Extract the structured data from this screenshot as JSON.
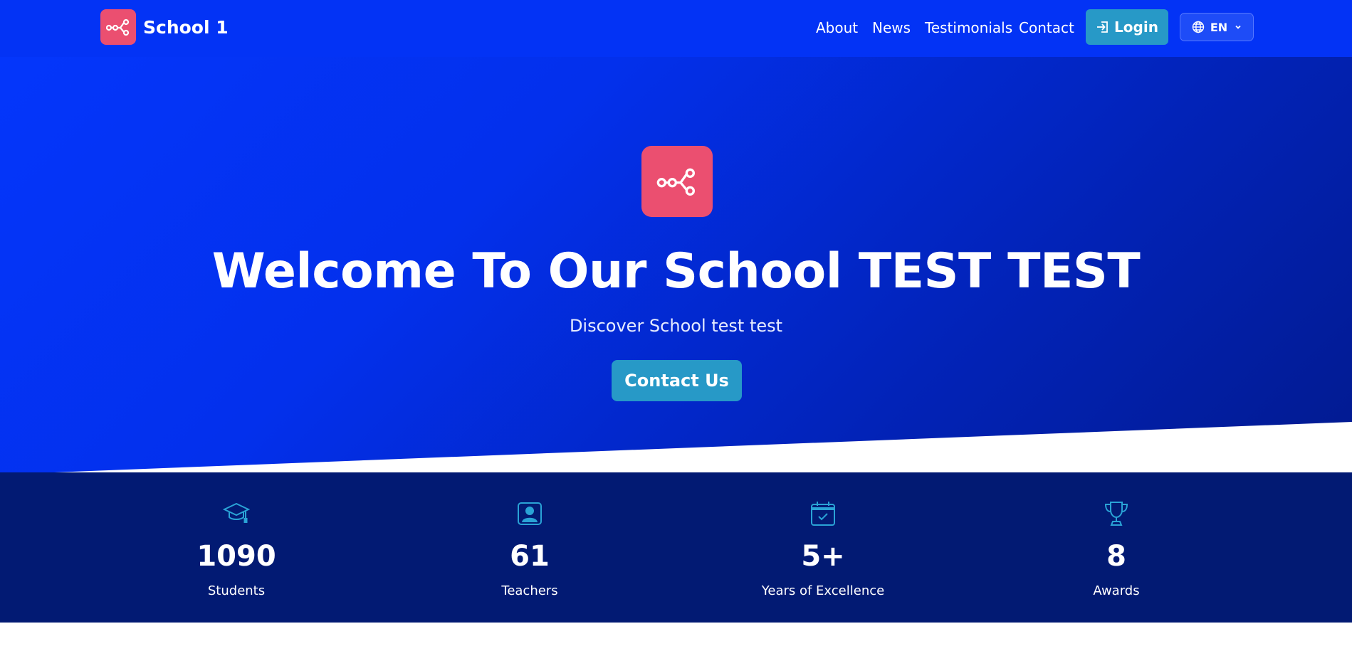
{
  "colors": {
    "nav_bg": "#0333f5",
    "hero_gradient_start": "#0436fb",
    "hero_gradient_end": "#021a8f",
    "brand_accent": "#eb4f70",
    "button_accent": "#2799c7",
    "stats_bg": "#021a73",
    "stat_icon": "#2aa3d6"
  },
  "navbar": {
    "brand_name": "School 1",
    "brand_icon": "share-nodes-icon",
    "links": [
      {
        "label": "About"
      },
      {
        "label": "News"
      },
      {
        "label": "Testimonials"
      },
      {
        "label": "Contact"
      }
    ],
    "login": {
      "label": "Login",
      "icon": "login-icon"
    },
    "language": {
      "label": "EN",
      "icon": "globe-icon"
    }
  },
  "hero": {
    "logo_icon": "share-nodes-icon",
    "title": "Welcome To Our School TEST TEST",
    "subtitle": "Discover School test test",
    "cta_label": "Contact Us"
  },
  "stats": [
    {
      "icon": "graduation-cap-icon",
      "value": "1090",
      "label": "Students"
    },
    {
      "icon": "teacher-icon",
      "value": "61",
      "label": "Teachers"
    },
    {
      "icon": "calendar-check-icon",
      "value": "5+",
      "label": "Years of Excellence"
    },
    {
      "icon": "trophy-icon",
      "value": "8",
      "label": "Awards"
    }
  ]
}
